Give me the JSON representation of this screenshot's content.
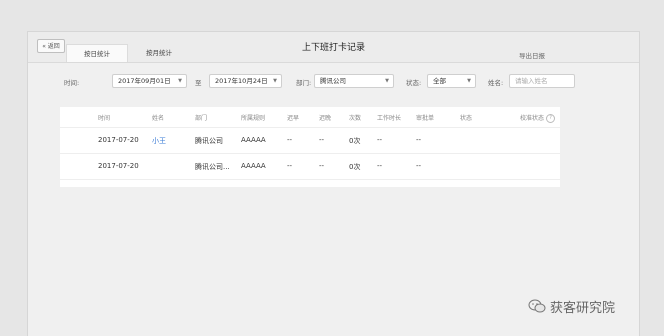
{
  "header": {
    "back_label": "« 返回",
    "title": "上下班打卡记录"
  },
  "tabs": [
    {
      "label": "按日统计",
      "active": true
    },
    {
      "label": "按月统计",
      "active": false
    }
  ],
  "export_label": "导出日报",
  "filters": {
    "time_label": "时间:",
    "start_date": "2017年09月01日",
    "to_label": "至",
    "end_date": "2017年10月24日",
    "dept_label": "部门:",
    "dept_value": "腾讯公司",
    "status_label": "状态:",
    "status_value": "全部",
    "name_label": "姓名:",
    "name_placeholder": "请输入姓名"
  },
  "table": {
    "columns": [
      "时间",
      "姓名",
      "部门",
      "所属规则",
      "迟早",
      "迟晚",
      "次数",
      "工作时长",
      "审批单",
      "状态",
      "校准状态"
    ],
    "rows": [
      [
        "2017-07-20",
        "小王",
        "腾讯公司",
        "AAAAA",
        "--",
        "--",
        "0次",
        "--",
        "--",
        "",
        ""
      ],
      [
        "2017-07-20",
        "",
        "腾讯公司...",
        "AAAAA",
        "--",
        "--",
        "0次",
        "--",
        "--",
        "",
        ""
      ]
    ]
  },
  "watermark": "获客研究院",
  "colors": {
    "link": "#3a7bd5",
    "background": "#e6e6e6"
  }
}
